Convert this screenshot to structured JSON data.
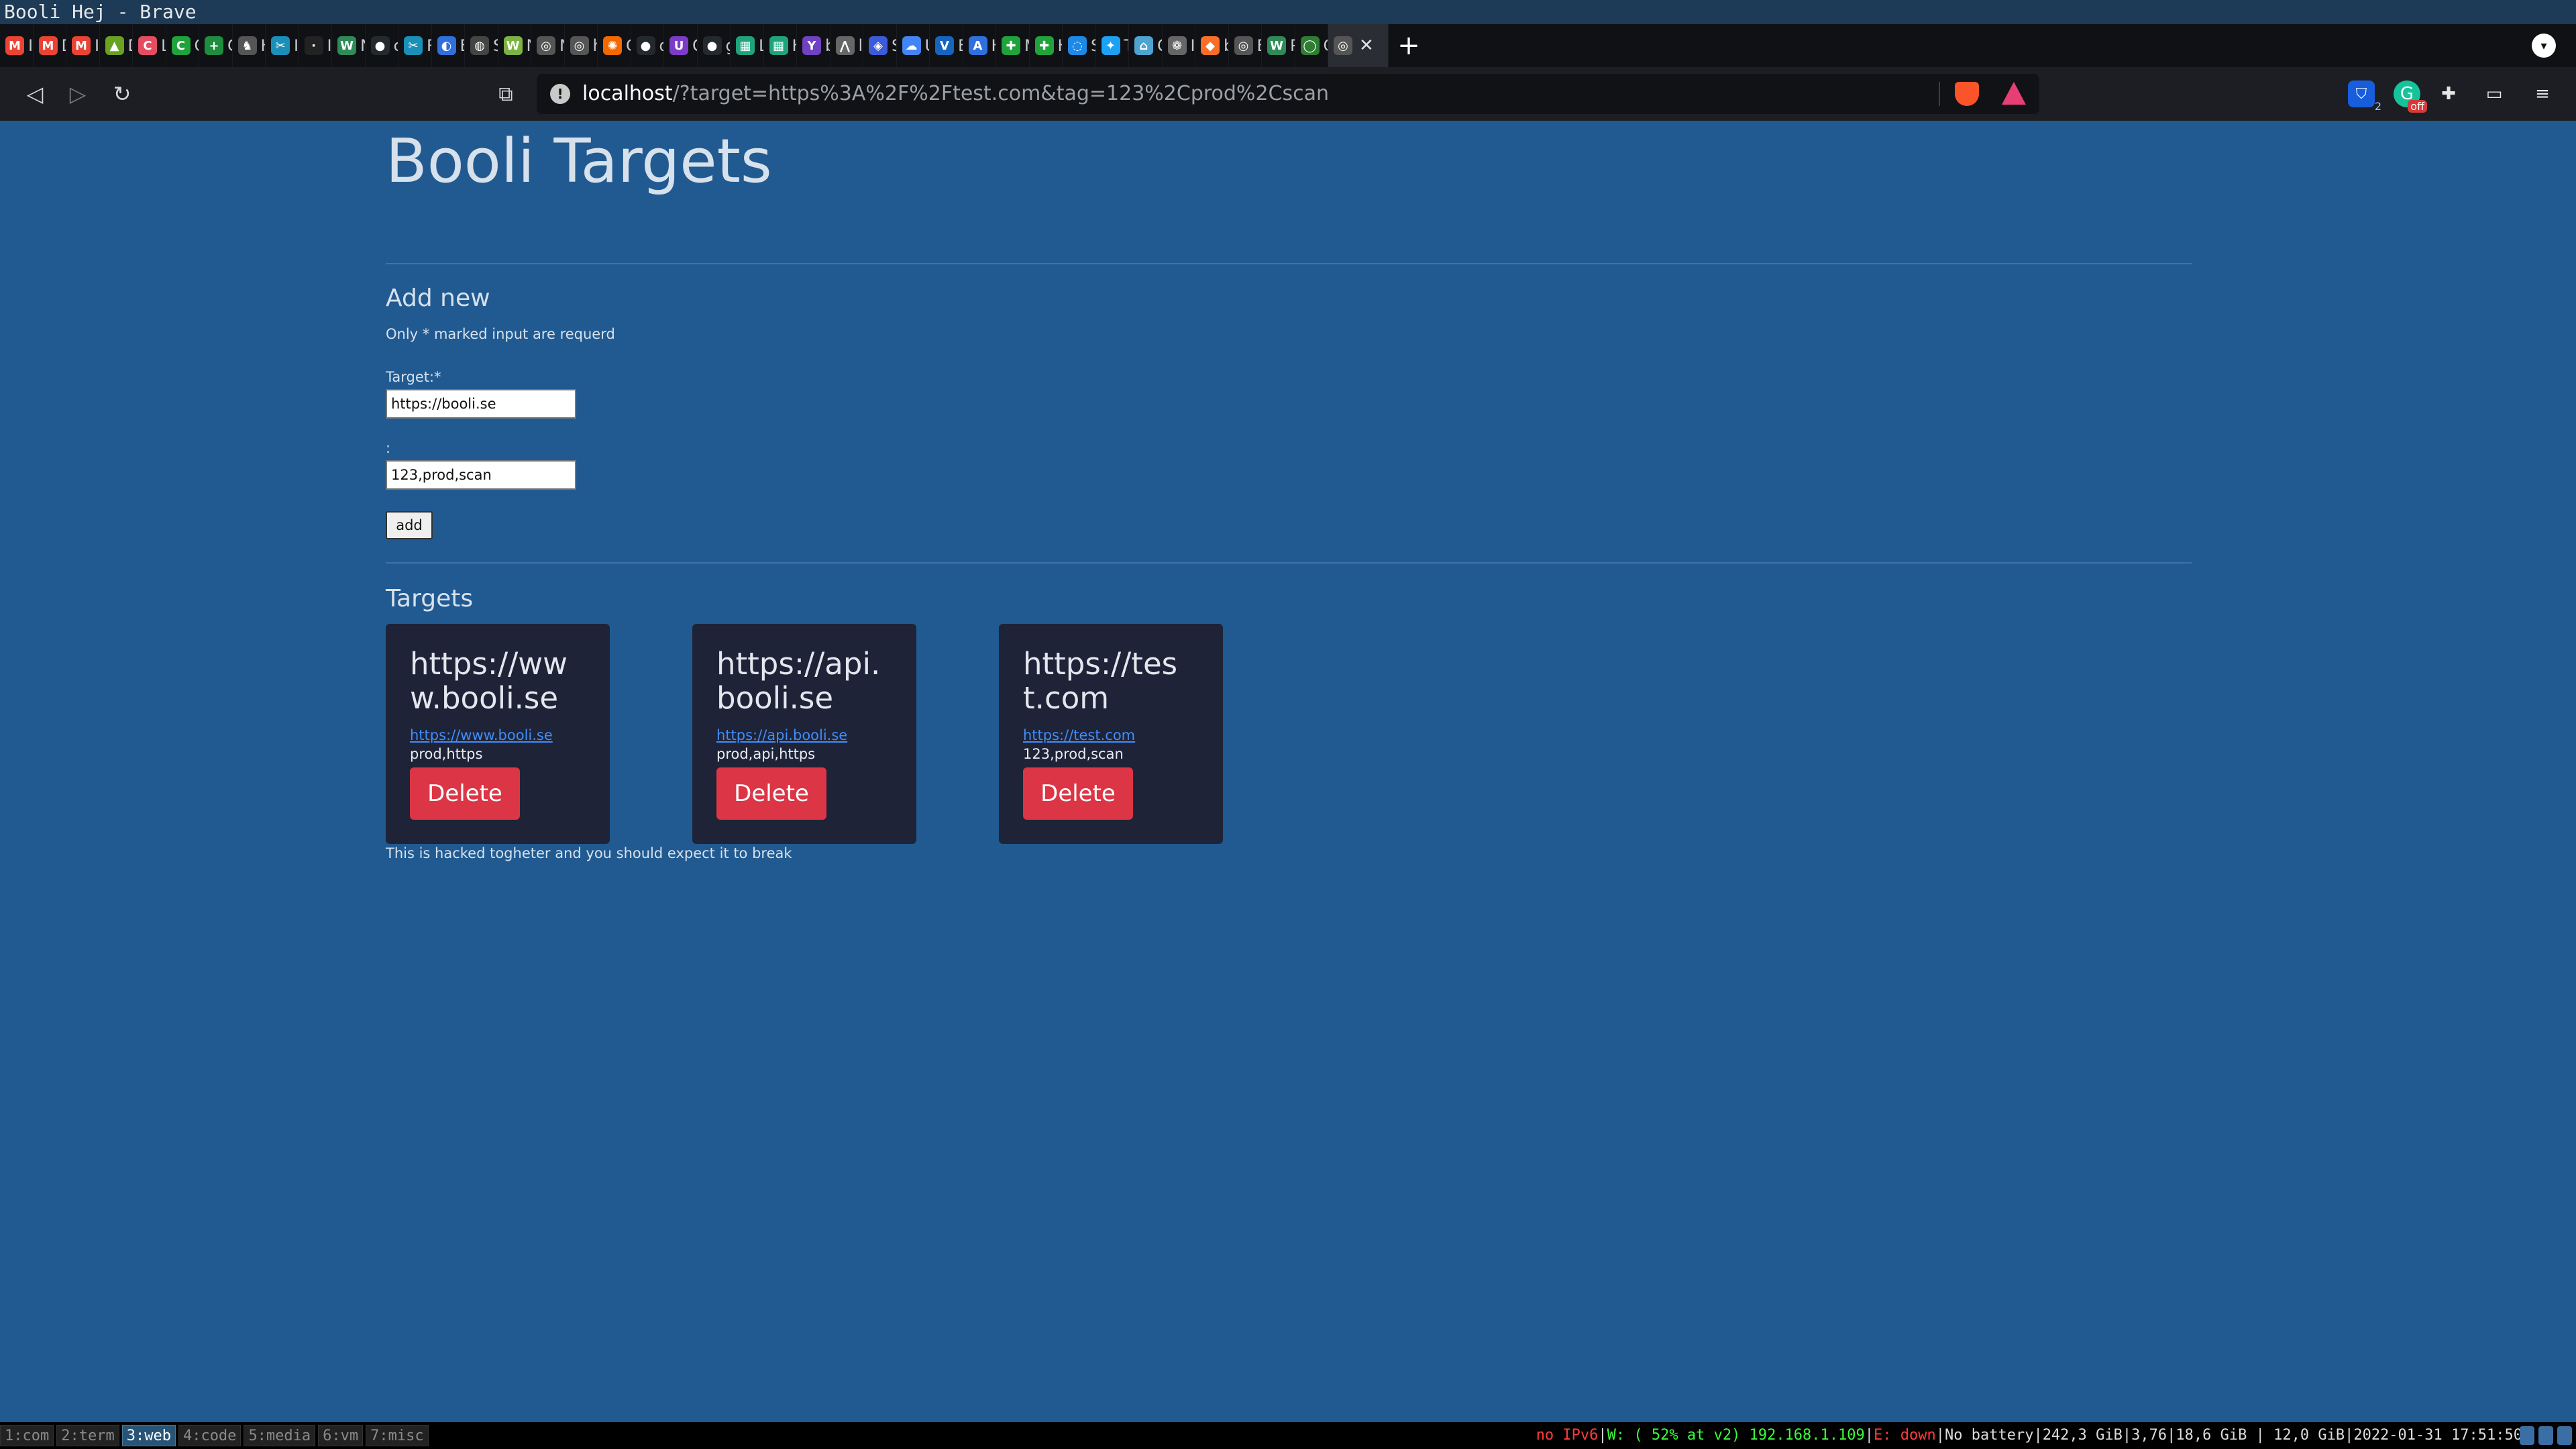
{
  "window": {
    "title": "Booli Hej - Brave"
  },
  "tabs": [
    {
      "label": "In",
      "color": "#ea4335",
      "glyph": "M"
    },
    {
      "label": "D",
      "color": "#ea4335",
      "glyph": "M"
    },
    {
      "label": "In",
      "color": "#ea4335",
      "glyph": "M"
    },
    {
      "label": "D",
      "color": "#6aa121",
      "glyph": "▲"
    },
    {
      "label": "Li",
      "color": "#e44d61",
      "glyph": "C"
    },
    {
      "label": "O",
      "color": "#1fa33a",
      "glyph": "C"
    },
    {
      "label": "G",
      "color": "#1e8e3e",
      "glyph": "+"
    },
    {
      "label": "H",
      "color": "#555555",
      "glyph": "♞"
    },
    {
      "label": "In",
      "color": "#1a8fb8",
      "glyph": "✂"
    },
    {
      "label": "In",
      "color": "#222222",
      "glyph": "·"
    },
    {
      "label": "N",
      "color": "#2e8b57",
      "glyph": "W"
    },
    {
      "label": "cl",
      "color": "#24292e",
      "glyph": "●"
    },
    {
      "label": "R",
      "color": "#1a8fb8",
      "glyph": "✂"
    },
    {
      "label": "E",
      "color": "#2f6fde",
      "glyph": "◐"
    },
    {
      "label": "S",
      "color": "#444444",
      "glyph": "◍"
    },
    {
      "label": "N",
      "color": "#7cb342",
      "glyph": "W"
    },
    {
      "label": "N",
      "color": "#555555",
      "glyph": "◎"
    },
    {
      "label": "hi",
      "color": "#555555",
      "glyph": "◎"
    },
    {
      "label": "G",
      "color": "#f46800",
      "glyph": "✺"
    },
    {
      "label": "d",
      "color": "#24292e",
      "glyph": "●"
    },
    {
      "label": "C",
      "color": "#7d3cc8",
      "glyph": "U"
    },
    {
      "label": "g",
      "color": "#24292e",
      "glyph": "●"
    },
    {
      "label": "Li",
      "color": "#1fa37a",
      "glyph": "▦"
    },
    {
      "label": "H",
      "color": "#1fa37a",
      "glyph": "▦"
    },
    {
      "label": "b",
      "color": "#6f42c1",
      "glyph": "Y"
    },
    {
      "label": "lo",
      "color": "#666666",
      "glyph": "⋀"
    },
    {
      "label": "S",
      "color": "#3b5bdb",
      "glyph": "◈"
    },
    {
      "label": "U",
      "color": "#4285f4",
      "glyph": "☁"
    },
    {
      "label": "E",
      "color": "#1565c0",
      "glyph": "V"
    },
    {
      "label": "H",
      "color": "#2f6fde",
      "glyph": "A"
    },
    {
      "label": "M",
      "color": "#1fa33a",
      "glyph": "✚"
    },
    {
      "label": "H",
      "color": "#1fa33a",
      "glyph": "✚"
    },
    {
      "label": "S",
      "color": "#1e88e5",
      "glyph": "◌"
    },
    {
      "label": "Tv",
      "color": "#1da1f2",
      "glyph": "✦"
    },
    {
      "label": "O",
      "color": "#4fa3d1",
      "glyph": "⌂"
    },
    {
      "label": "In",
      "color": "#666666",
      "glyph": "❁"
    },
    {
      "label": "b",
      "color": "#fc6d26",
      "glyph": "◆"
    },
    {
      "label": "B",
      "color": "#555555",
      "glyph": "◎"
    },
    {
      "label": "P",
      "color": "#2e8b57",
      "glyph": "W"
    },
    {
      "label": "C",
      "color": "#2e7d32",
      "glyph": "◯"
    }
  ],
  "active_tab": {
    "glyph": "◎",
    "close": "✕"
  },
  "new_tab_glyph": "+",
  "tab_menu_glyph": "▾",
  "toolbar": {
    "back": "◁",
    "forward": "▷",
    "reload": "↻",
    "bookmark": "⧉",
    "url_host": "localhost",
    "url_query": "/?target=https%3A%2F%2Ftest.com&tag=123%2Cprod%2Cscan",
    "info": "!"
  },
  "extensions": {
    "bitwarden_badge": "2",
    "grammarly_badge": "off",
    "puzzle": "✚",
    "wallet": "▭",
    "menu": "≡"
  },
  "page": {
    "title": "Booli Targets",
    "add_new": "Add new",
    "required_note": "Only * marked input are requerd",
    "target_label": "Target:*",
    "target_value": "https://booli.se",
    "tag_label": ":",
    "tag_value": "123,prod,scan",
    "add_button": "add",
    "targets_title": "Targets",
    "footer_note": "This is hacked togheter and you should expect it to break"
  },
  "targets": [
    {
      "title": "https://www.booli.se",
      "link": "https://www.booli.se",
      "tags": "prod,https",
      "delete": "Delete"
    },
    {
      "title": "https://api.booli.se",
      "link": "https://api.booli.se",
      "tags": "prod,api,https",
      "delete": "Delete"
    },
    {
      "title": "https://test.com",
      "link": "https://test.com",
      "tags": "123,prod,scan",
      "delete": "Delete"
    }
  ],
  "statusbar": {
    "workspaces": [
      {
        "label": "1:com",
        "active": false
      },
      {
        "label": "2:term",
        "active": false
      },
      {
        "label": "3:web",
        "active": true
      },
      {
        "label": "4:code",
        "active": false
      },
      {
        "label": "5:media",
        "active": false
      },
      {
        "label": "6:vm",
        "active": false
      },
      {
        "label": "7:misc",
        "active": false
      }
    ],
    "ipv6": "no IPv6",
    "wifi": "W: ( 52% at v2) 192.168.1.109",
    "ethernet": "E: down",
    "battery": "No battery",
    "disk": "242,3 GiB",
    "load": "3,76",
    "mem_free": "18,6 GiB",
    "mem_used": "12,0 GiB",
    "datetime": "2022-01-31 17:51:50"
  }
}
